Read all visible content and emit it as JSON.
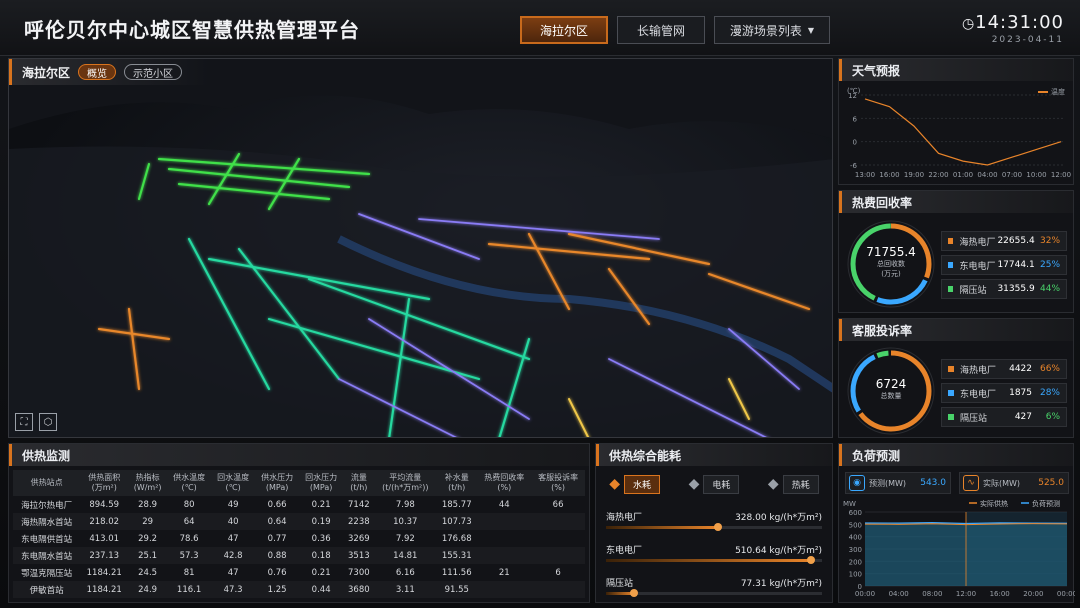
{
  "header": {
    "title": "呼伦贝尔中心城区智慧供热管理平台",
    "nav": [
      "海拉尔区",
      "长输管网",
      "漫游场景列表"
    ],
    "time": "14:31:00",
    "date": "2023-04-11"
  },
  "map": {
    "title": "海拉尔区",
    "pills": [
      "概览",
      "示范小区"
    ]
  },
  "weather": {
    "title": "天气预报",
    "unit": "(℃)",
    "legend": "温度",
    "chart_data": {
      "type": "line",
      "categories": [
        "13:00",
        "16:00",
        "19:00",
        "22:00",
        "01:00",
        "04:00",
        "07:00",
        "10:00",
        "12:00"
      ],
      "series": [
        {
          "name": "温度",
          "values": [
            11,
            9,
            4,
            -3,
            -5,
            -6,
            -4,
            -2,
            0
          ]
        }
      ],
      "ylim": [
        -6,
        12
      ],
      "yticks": [
        "12",
        "6",
        "0",
        "-6"
      ]
    }
  },
  "fee": {
    "title": "热费回收率",
    "center_value": "71755.4",
    "center_l1": "总回收数",
    "center_l2": "(万元)",
    "items": [
      {
        "name": "海热电厂",
        "value": "22655.4",
        "pct": "32%",
        "color": "#e8842a"
      },
      {
        "name": "东电电厂",
        "value": "17744.1",
        "pct": "25%",
        "color": "#3aa8ff"
      },
      {
        "name": "隔压站",
        "value": "31355.9",
        "pct": "44%",
        "color": "#49d36a"
      }
    ]
  },
  "complaint": {
    "title": "客服投诉率",
    "center_value": "6724",
    "center_l1": "总数量",
    "items": [
      {
        "name": "海热电厂",
        "value": "4422",
        "pct": "66%",
        "color": "#e8842a"
      },
      {
        "name": "东电电厂",
        "value": "1875",
        "pct": "28%",
        "color": "#3aa8ff"
      },
      {
        "name": "隔压站",
        "value": "427",
        "pct": "6%",
        "color": "#49d36a"
      }
    ]
  },
  "monitor": {
    "title": "供热监测",
    "headers": [
      "供热站点",
      "供热面积\n(万m²)",
      "热指标\n(W/m²)",
      "供水温度\n(℃)",
      "回水温度\n(℃)",
      "供水压力\n(MPa)",
      "回水压力\n(MPa)",
      "流量\n(t/h)",
      "平均流量\n(t/(h*万m²))",
      "补水量\n(t/h)",
      "热费回收率\n(%)",
      "客服投诉率\n(%)"
    ],
    "rows": [
      [
        "海拉尔热电厂",
        "894.59",
        "28.9",
        "80",
        "49",
        "0.66",
        "0.21",
        "7142",
        "7.98",
        "185.77",
        "44",
        "66"
      ],
      [
        "海热隔水首站",
        "218.02",
        "29",
        "64",
        "40",
        "0.64",
        "0.19",
        "2238",
        "10.37",
        "107.73",
        "",
        ""
      ],
      [
        "东电隔供首站",
        "413.01",
        "29.2",
        "78.6",
        "47",
        "0.77",
        "0.36",
        "3269",
        "7.92",
        "176.68",
        "",
        ""
      ],
      [
        "东电隔水首站",
        "237.13",
        "25.1",
        "57.3",
        "42.8",
        "0.88",
        "0.18",
        "3513",
        "14.81",
        "155.31",
        "",
        ""
      ],
      [
        "鄂温克隔压站",
        "1184.21",
        "24.5",
        "81",
        "47",
        "0.76",
        "0.21",
        "7300",
        "6.16",
        "111.56",
        "21",
        "6"
      ],
      [
        "伊敏首站",
        "1184.21",
        "24.9",
        "116.1",
        "47.3",
        "1.25",
        "0.44",
        "3680",
        "3.11",
        "91.55",
        "",
        ""
      ]
    ]
  },
  "energy": {
    "title": "供热综合能耗",
    "tabs": [
      "水耗",
      "电耗",
      "热耗"
    ],
    "items": [
      {
        "name": "海热电厂",
        "value": "328.00 kg/(h*万m²)",
        "level": 0.52
      },
      {
        "name": "东电电厂",
        "value": "510.64 kg/(h*万m²)",
        "level": 0.95
      },
      {
        "name": "隔压站",
        "value": "77.31 kg/(h*万m²)",
        "level": 0.13
      }
    ]
  },
  "load": {
    "title": "负荷预测",
    "forecast_label": "预测(MW)",
    "forecast_value": "543.0",
    "actual_label": "实际(MW)",
    "actual_value": "525.0",
    "chart_data": {
      "type": "area",
      "categories": [
        "00:00",
        "04:00",
        "08:00",
        "12:00",
        "16:00",
        "20:00",
        "00:00"
      ],
      "series": [
        {
          "name": "实际供热",
          "values": [
            502,
            500,
            505,
            498,
            503,
            506,
            504
          ]
        },
        {
          "name": "负荷预测",
          "values": [
            511,
            510,
            514,
            507,
            512,
            510,
            509
          ]
        }
      ],
      "ylim": [
        0,
        600
      ],
      "yticks": [
        "600",
        "500",
        "400",
        "300",
        "200",
        "100",
        "0"
      ],
      "ylabel": "MW",
      "legend": [
        "实际供热",
        "负荷预测"
      ]
    }
  }
}
